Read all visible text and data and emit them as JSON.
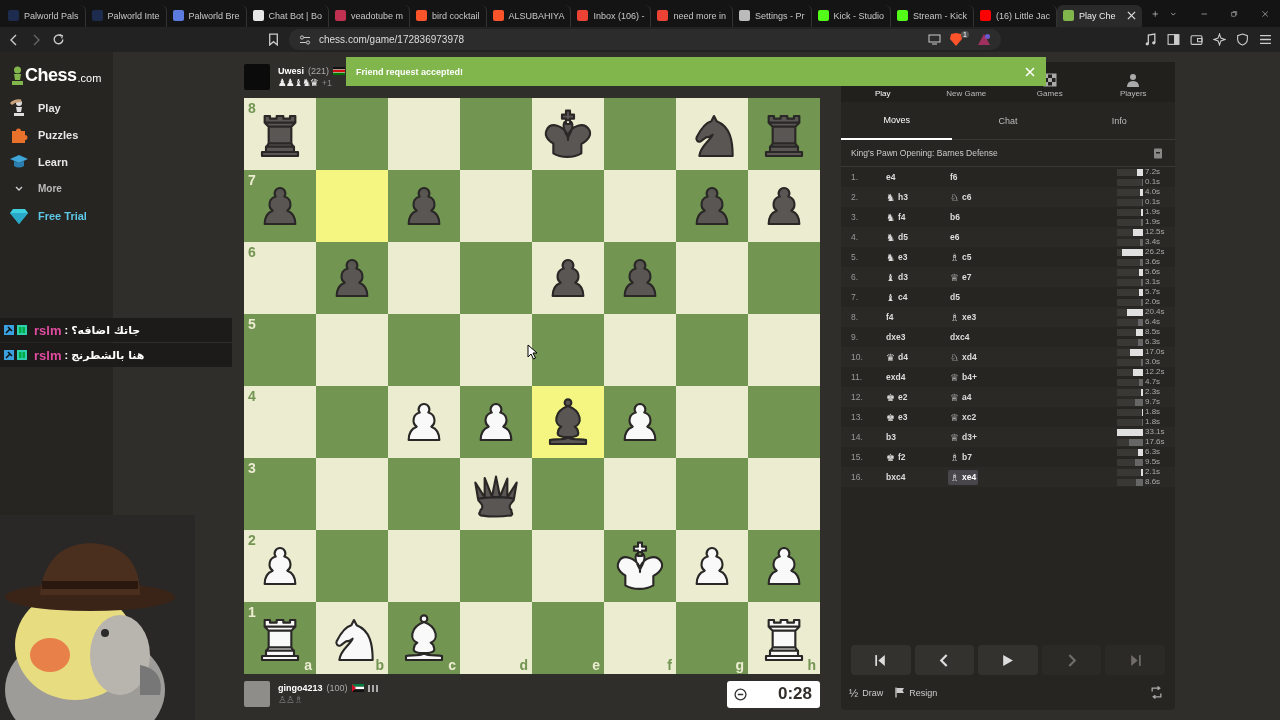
{
  "browser": {
    "tabs": [
      {
        "title": "Palworld Pals",
        "color": "#1d2b4f",
        "selected": false
      },
      {
        "title": "Palworld Inte",
        "color": "#1d2b4f",
        "selected": false
      },
      {
        "title": "Palworld Bre",
        "color": "#5b7be0",
        "selected": false
      },
      {
        "title": "Chat Bot | Bo",
        "color": "#e8e8e8",
        "selected": false
      },
      {
        "title": "veadotube m",
        "color": "#c03050",
        "selected": false
      },
      {
        "title": "bird cocktail",
        "color": "#fb542b",
        "selected": false
      },
      {
        "title": "ALSUBAHIYA",
        "color": "#fb542b",
        "selected": false
      },
      {
        "title": "Inbox (106) -",
        "color": "#ea4335",
        "selected": false
      },
      {
        "title": "need more in",
        "color": "#ea4335",
        "selected": false
      },
      {
        "title": "Settings - Pr",
        "color": "#bbbbbb",
        "selected": false
      },
      {
        "title": "Kick - Studio",
        "color": "#53fc18",
        "selected": false
      },
      {
        "title": "Stream - Kick",
        "color": "#53fc18",
        "selected": false
      },
      {
        "title": "(16) Little Jac",
        "color": "#ff0000",
        "selected": false
      },
      {
        "title": "Play Che",
        "color": "#81b64c",
        "selected": true
      }
    ],
    "address": "chess.com/game/172836973978",
    "extension_badge": "1"
  },
  "toast": {
    "message": "Friend request accepted!"
  },
  "sidebar": {
    "logo": {
      "name": "Chess",
      "suffix": ".com"
    },
    "items": [
      {
        "label": "Play",
        "kind": "play"
      },
      {
        "label": "Puzzles",
        "kind": "puzzles"
      },
      {
        "label": "Learn",
        "kind": "learn"
      },
      {
        "label": "More",
        "kind": "more"
      },
      {
        "label": "Free Trial",
        "kind": "trial"
      }
    ]
  },
  "top_player": {
    "name": "Uwesi",
    "rating": "(221)",
    "captured": "♟♟♝♞♛",
    "advantage": "+1"
  },
  "board": {
    "files": [
      "a",
      "b",
      "c",
      "d",
      "e",
      "f",
      "g",
      "h"
    ],
    "ranks": [
      {
        "label": "8",
        "squares": [
          {
            "kind": "rook",
            "white": false,
            "highlighted": false
          },
          {
            "highlighted": false
          },
          {
            "highlighted": false
          },
          {
            "highlighted": false
          },
          {
            "kind": "king",
            "white": false,
            "highlighted": false
          },
          {
            "highlighted": false
          },
          {
            "kind": "knight",
            "white": false,
            "highlighted": false
          },
          {
            "kind": "rook",
            "white": false,
            "highlighted": false
          }
        ]
      },
      {
        "label": "7",
        "squares": [
          {
            "kind": "pawn",
            "white": false,
            "highlighted": false
          },
          {
            "highlighted": true
          },
          {
            "kind": "pawn",
            "white": false,
            "highlighted": false
          },
          {
            "highlighted": false
          },
          {
            "highlighted": false
          },
          {
            "highlighted": false
          },
          {
            "kind": "pawn",
            "white": false,
            "highlighted": false
          },
          {
            "kind": "pawn",
            "white": false,
            "highlighted": false
          }
        ]
      },
      {
        "label": "6",
        "squares": [
          {
            "highlighted": false
          },
          {
            "kind": "pawn",
            "white": false,
            "highlighted": false
          },
          {
            "highlighted": false
          },
          {
            "highlighted": false
          },
          {
            "kind": "pawn",
            "white": false,
            "highlighted": false
          },
          {
            "kind": "pawn",
            "white": false,
            "highlighted": false
          },
          {
            "highlighted": false
          },
          {
            "highlighted": false
          }
        ]
      },
      {
        "label": "5",
        "squares": [
          {
            "highlighted": false
          },
          {
            "highlighted": false
          },
          {
            "highlighted": false
          },
          {
            "highlighted": false
          },
          {
            "highlighted": false
          },
          {
            "highlighted": false
          },
          {
            "highlighted": false
          },
          {
            "highlighted": false
          }
        ]
      },
      {
        "label": "4",
        "squares": [
          {
            "highlighted": false
          },
          {
            "highlighted": false
          },
          {
            "kind": "pawn",
            "white": true,
            "highlighted": false
          },
          {
            "kind": "pawn",
            "white": true,
            "highlighted": false
          },
          {
            "kind": "bishop",
            "white": false,
            "highlighted": true
          },
          {
            "kind": "pawn",
            "white": true,
            "highlighted": false
          },
          {
            "highlighted": false
          },
          {
            "highlighted": false
          }
        ]
      },
      {
        "label": "3",
        "squares": [
          {
            "highlighted": false
          },
          {
            "highlighted": false
          },
          {
            "highlighted": false
          },
          {
            "kind": "queen",
            "white": false,
            "highlighted": false
          },
          {
            "highlighted": false
          },
          {
            "highlighted": false
          },
          {
            "highlighted": false
          },
          {
            "highlighted": false
          }
        ]
      },
      {
        "label": "2",
        "squares": [
          {
            "kind": "pawn",
            "white": true,
            "highlighted": false
          },
          {
            "highlighted": false
          },
          {
            "highlighted": false
          },
          {
            "highlighted": false
          },
          {
            "highlighted": false
          },
          {
            "kind": "king",
            "white": true,
            "highlighted": false
          },
          {
            "kind": "pawn",
            "white": true,
            "highlighted": false
          },
          {
            "kind": "pawn",
            "white": true,
            "highlighted": false
          }
        ]
      },
      {
        "label": "1",
        "squares": [
          {
            "kind": "rook",
            "white": true,
            "highlighted": false
          },
          {
            "kind": "knight",
            "white": true,
            "highlighted": false
          },
          {
            "kind": "bishop",
            "white": true,
            "highlighted": false
          },
          {
            "highlighted": false
          },
          {
            "highlighted": false
          },
          {
            "highlighted": false
          },
          {
            "highlighted": false
          },
          {
            "kind": "rook",
            "white": true,
            "highlighted": false
          }
        ]
      }
    ]
  },
  "bottom_player": {
    "name": "gingo4213",
    "rating": "(100)",
    "captured": "♙♙♗",
    "clock": "0:28"
  },
  "panel": {
    "nav": [
      {
        "label": "Play",
        "selected": true
      },
      {
        "label": "New Game",
        "selected": false
      },
      {
        "label": "Games",
        "kind": "games",
        "selected": false
      },
      {
        "label": "Players",
        "kind": "players",
        "selected": false
      }
    ],
    "tabs": [
      {
        "label": "Moves",
        "selected": true
      },
      {
        "label": "Chat",
        "selected": false
      },
      {
        "label": "Info",
        "selected": false
      }
    ],
    "opening": "King's Pawn Opening: Barnes Defense",
    "moves": [
      {
        "number": "1.",
        "white": {
          "san": "e4",
          "selected": false
        },
        "black": {
          "san": "f6",
          "selected": false
        },
        "white_clock": {
          "time": "7.2s",
          "level": 0.22
        },
        "black_clock": {
          "time": "0.1s",
          "level": 0.01
        }
      },
      {
        "number": "2.",
        "white": {
          "piece": "♞",
          "san": "h3",
          "selected": false
        },
        "black": {
          "piece": "♘",
          "san": "c6",
          "selected": false
        },
        "white_clock": {
          "time": "4.0s",
          "level": 0.12
        },
        "black_clock": {
          "time": "0.1s",
          "level": 0.01
        }
      },
      {
        "number": "3.",
        "white": {
          "piece": "♞",
          "san": "f4",
          "selected": false
        },
        "black": {
          "san": "b6",
          "selected": false
        },
        "white_clock": {
          "time": "1.9s",
          "level": 0.06
        },
        "black_clock": {
          "time": "1.9s",
          "level": 0.06
        }
      },
      {
        "number": "4.",
        "white": {
          "piece": "♞",
          "san": "d5",
          "selected": false
        },
        "black": {
          "san": "e6",
          "selected": false
        },
        "white_clock": {
          "time": "12.5s",
          "level": 0.38
        },
        "black_clock": {
          "time": "3.4s",
          "level": 0.1
        }
      },
      {
        "number": "5.",
        "white": {
          "piece": "♞",
          "san": "e3",
          "selected": false
        },
        "black": {
          "piece": "♗",
          "san": "c5",
          "selected": false
        },
        "white_clock": {
          "time": "26.2s",
          "level": 0.79
        },
        "black_clock": {
          "time": "3.6s",
          "level": 0.11
        }
      },
      {
        "number": "6.",
        "white": {
          "piece": "♝",
          "san": "d3",
          "selected": false
        },
        "black": {
          "piece": "♕",
          "san": "e7",
          "selected": false
        },
        "white_clock": {
          "time": "5.6s",
          "level": 0.17
        },
        "black_clock": {
          "time": "3.1s",
          "level": 0.09
        }
      },
      {
        "number": "7.",
        "white": {
          "piece": "♝",
          "san": "c4",
          "selected": false
        },
        "black": {
          "san": "d5",
          "selected": false
        },
        "white_clock": {
          "time": "5.7s",
          "level": 0.17
        },
        "black_clock": {
          "time": "2.0s",
          "level": 0.06
        }
      },
      {
        "number": "8.",
        "white": {
          "san": "f4",
          "selected": false
        },
        "black": {
          "piece": "♗",
          "san": "xe3",
          "selected": false
        },
        "white_clock": {
          "time": "20.4s",
          "level": 0.62
        },
        "black_clock": {
          "time": "6.4s",
          "level": 0.19
        }
      },
      {
        "number": "9.",
        "white": {
          "san": "dxe3",
          "selected": false
        },
        "black": {
          "san": "dxc4",
          "selected": false
        },
        "white_clock": {
          "time": "8.5s",
          "level": 0.26
        },
        "black_clock": {
          "time": "6.3s",
          "level": 0.19
        }
      },
      {
        "number": "10.",
        "white": {
          "piece": "♛",
          "san": "d4",
          "selected": false
        },
        "black": {
          "piece": "♘",
          "san": "xd4",
          "selected": false
        },
        "white_clock": {
          "time": "17.0s",
          "level": 0.51
        },
        "black_clock": {
          "time": "3.0s",
          "level": 0.09
        }
      },
      {
        "number": "11.",
        "white": {
          "san": "exd4",
          "selected": false
        },
        "black": {
          "piece": "♕",
          "san": "b4+",
          "selected": false
        },
        "white_clock": {
          "time": "12.2s",
          "level": 0.37
        },
        "black_clock": {
          "time": "4.7s",
          "level": 0.14
        }
      },
      {
        "number": "12.",
        "white": {
          "piece": "♚",
          "san": "e2",
          "selected": false
        },
        "black": {
          "piece": "♕",
          "san": "a4",
          "selected": false
        },
        "white_clock": {
          "time": "2.3s",
          "level": 0.07
        },
        "black_clock": {
          "time": "9.7s",
          "level": 0.29
        }
      },
      {
        "number": "13.",
        "white": {
          "piece": "♚",
          "san": "e3",
          "selected": false
        },
        "black": {
          "piece": "♕",
          "san": "xc2",
          "selected": false
        },
        "white_clock": {
          "time": "1.8s",
          "level": 0.05
        },
        "black_clock": {
          "time": "1.8s",
          "level": 0.05
        }
      },
      {
        "number": "14.",
        "white": {
          "san": "b3",
          "selected": false
        },
        "black": {
          "piece": "♕",
          "san": "d3+",
          "selected": false
        },
        "white_clock": {
          "time": "33.1s",
          "level": 1
        },
        "black_clock": {
          "time": "17.6s",
          "level": 0.53
        }
      },
      {
        "number": "15.",
        "white": {
          "piece": "♚",
          "san": "f2",
          "selected": false
        },
        "black": {
          "piece": "♗",
          "san": "b7",
          "selected": false
        },
        "white_clock": {
          "time": "6.3s",
          "level": 0.19
        },
        "black_clock": {
          "time": "9.5s",
          "level": 0.29
        }
      },
      {
        "number": "16.",
        "white": {
          "san": "bxc4",
          "selected": false
        },
        "black": {
          "piece": "♗",
          "san": "xe4",
          "selected": true
        },
        "white_clock": {
          "time": "2.1s",
          "level": 0.06
        },
        "black_clock": {
          "time": "8.6s",
          "level": 0.26
        }
      }
    ],
    "controls": [
      {
        "kind": "first",
        "disabled": false
      },
      {
        "kind": "prev",
        "disabled": false
      },
      {
        "kind": "play",
        "disabled": false
      },
      {
        "kind": "next",
        "disabled": true
      },
      {
        "kind": "last",
        "disabled": true
      }
    ],
    "draw_symbol": "½",
    "draw": "Draw",
    "resign": "Resign"
  },
  "chat": {
    "separator": ":",
    "messages": [
      {
        "user": "rslm",
        "message": "جاتك اضافه؟"
      },
      {
        "user": "rslm",
        "message": "هنا بالشطرنج"
      }
    ]
  }
}
